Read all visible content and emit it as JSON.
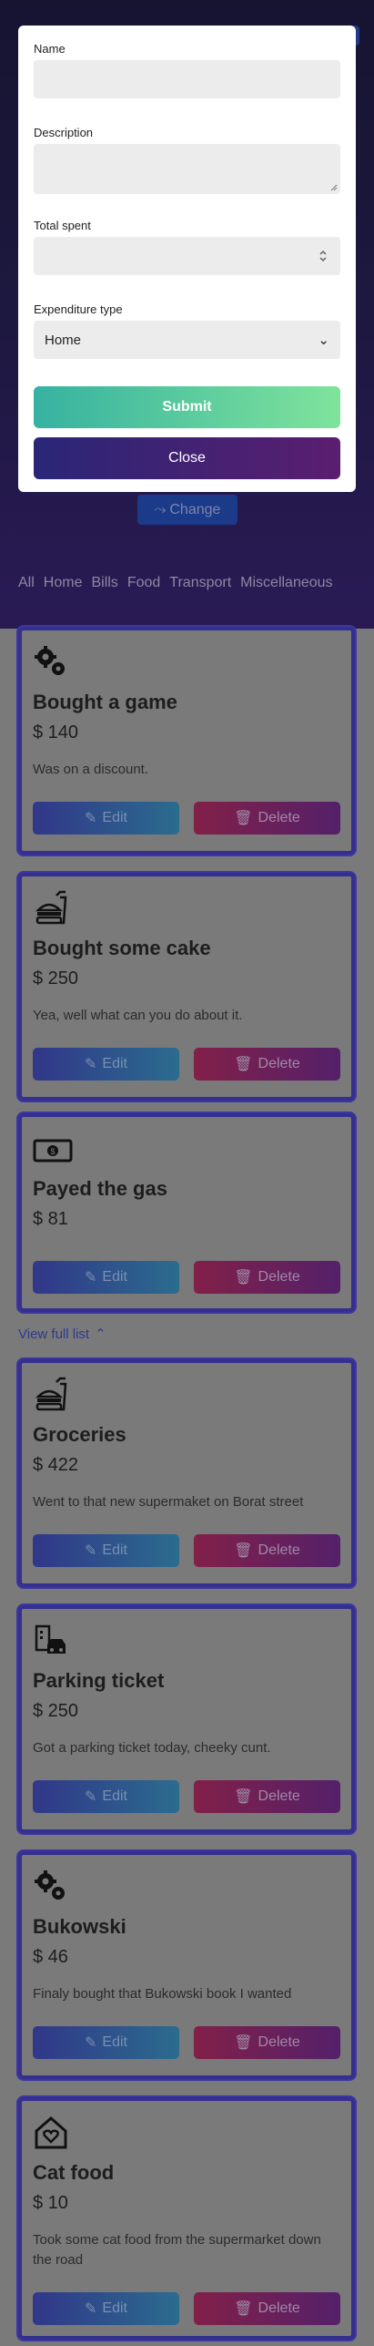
{
  "modal": {
    "name_label": "Name",
    "name_value": "",
    "description_label": "Description",
    "description_value": "",
    "total_label": "Total spent",
    "total_value": "",
    "type_label": "Expenditure type",
    "type_selected": "Home",
    "submit_label": "Submit",
    "close_label": "Close"
  },
  "change_label": "Change",
  "filters": [
    "All",
    "Home",
    "Bills",
    "Food",
    "Transport",
    "Miscellaneous"
  ],
  "view_full_label": "View full list",
  "edit_label": "Edit",
  "delete_label": "Delete",
  "cards": [
    {
      "icon": "gears-icon",
      "title": "Bought a game",
      "amount": "$ 140",
      "description": "Was on a discount."
    },
    {
      "icon": "food-icon",
      "title": "Bought some cake",
      "amount": "$ 250",
      "description": "Yea, well what can you do about it."
    },
    {
      "icon": "money-icon",
      "title": "Payed the gas",
      "amount": "$ 81",
      "description": ""
    },
    {
      "icon": "food-icon",
      "title": "Groceries",
      "amount": "$ 422",
      "description": "Went to that new supermaket on Borat street"
    },
    {
      "icon": "car-building-icon",
      "title": "Parking ticket",
      "amount": "$ 250",
      "description": "Got a parking ticket today, cheeky cunt."
    },
    {
      "icon": "gears-icon",
      "title": "Bukowski",
      "amount": "$ 46",
      "description": "Finaly bought that Bukowski book I wanted"
    },
    {
      "icon": "home-heart-icon",
      "title": "Cat food",
      "amount": "$ 10",
      "description": "Took some cat food from the supermarket down the road"
    }
  ],
  "colors": {
    "accent_submit": "#36b2a1",
    "accent_close": "#2a2677",
    "card_border": "#352f8f"
  }
}
